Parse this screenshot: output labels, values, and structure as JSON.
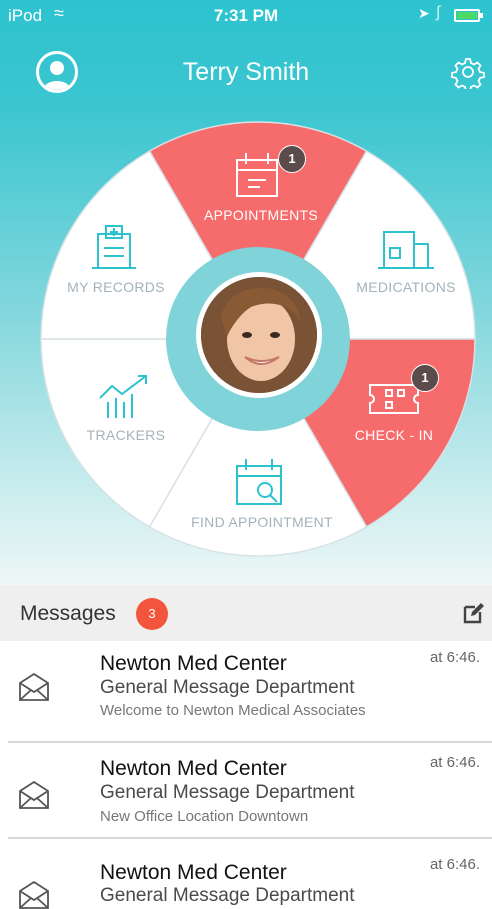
{
  "status_bar": {
    "carrier": "iPod",
    "time": "7:31 PM"
  },
  "header": {
    "title": "Terry Smith"
  },
  "wheel": {
    "segments": [
      {
        "label": "APPOINTMENTS",
        "badge": "1",
        "active": true
      },
      {
        "label": "MEDICATIONS",
        "active": false
      },
      {
        "label": "CHECK - IN",
        "badge": "1",
        "active": true
      },
      {
        "label": "FIND APPOINTMENT",
        "active": false
      },
      {
        "label": "TRACKERS",
        "active": false
      },
      {
        "label": "MY RECORDS",
        "active": false
      }
    ],
    "colors": {
      "active": "#f66b6b",
      "inactive": "#ffffff",
      "ring": "#7fd3d9"
    }
  },
  "messages": {
    "title": "Messages",
    "count": "3",
    "items": [
      {
        "from": "Newton Med Center",
        "department": "General Message Department",
        "body": "Welcome to Newton Medical Associates",
        "time": "at 6:46."
      },
      {
        "from": "Newton Med Center",
        "department": "General Message Department",
        "body": "New Office Location Downtown",
        "time": "at 6:46."
      },
      {
        "from": "Newton Med Center",
        "department": "General Message Department",
        "body": "",
        "time": "at 6:46."
      }
    ]
  },
  "colors": {
    "primary": "#2cc3cf",
    "badge_dark": "#5b4b4b",
    "badge_red": "#f2553b"
  }
}
